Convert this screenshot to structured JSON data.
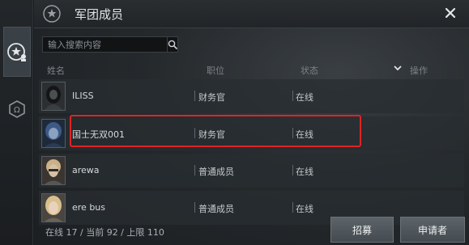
{
  "window": {
    "title": "军团成员",
    "close_icon": "close-icon"
  },
  "sidebar": {
    "items": [
      {
        "icon": "legion-members-icon",
        "active": true
      },
      {
        "icon": "legion-info-icon",
        "active": false
      }
    ]
  },
  "search": {
    "placeholder": "输入搜索内容",
    "icon": "search-icon"
  },
  "table": {
    "headers": {
      "name": "姓名",
      "role": "职位",
      "status": "状态",
      "action": "操作"
    },
    "rows": [
      {
        "name": "ILISS",
        "role": "财务官",
        "status": "在线",
        "avatar": "dark-hooded-avatar"
      },
      {
        "name": "国士无双001",
        "role": "财务官",
        "status": "在线",
        "avatar": "blue-haired-avatar"
      },
      {
        "name": "arewa",
        "role": "普通成员",
        "status": "在线",
        "avatar": "blond-avatar"
      },
      {
        "name": "ere bus",
        "role": "普通成员",
        "status": "在线",
        "avatar": "blond-female-avatar"
      }
    ]
  },
  "footer": {
    "stats": "在线 17 / 当前 92 / 上限 110",
    "recruit_label": "招募",
    "applicants_label": "申请者"
  },
  "colors": {
    "highlight": "#e02424",
    "panel_bg": "#25292c",
    "text": "#cfd3d6"
  }
}
